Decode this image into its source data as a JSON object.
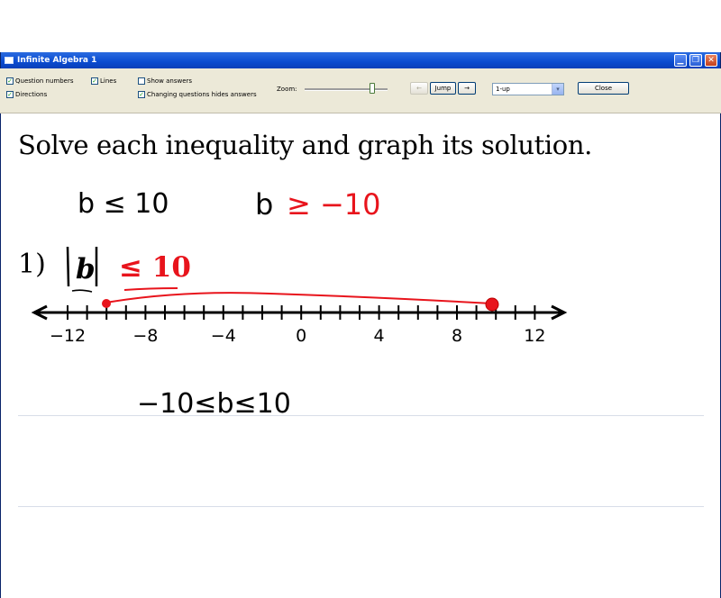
{
  "window": {
    "title": "Infinite Algebra 1"
  },
  "toolbar": {
    "question_numbers": "Question numbers",
    "lines": "Lines",
    "directions": "Directions",
    "show_answers": "Show answers",
    "changing_hides": "Changing questions hides answers",
    "zoom_label": "Zoom:",
    "back_arrow": "←",
    "jump_label": "Jump",
    "forward_arrow": "→",
    "layout_select": "1-up",
    "close_label": "Close",
    "checked": {
      "question_numbers": true,
      "lines": true,
      "directions": true,
      "show_answers": false,
      "changing_hides": true
    }
  },
  "worksheet": {
    "instructions": "Solve each inequality and graph its solution.",
    "question_number": "1)",
    "problem_variable": "b",
    "problem_inequality": "≤ 10",
    "number_line_ticks": [
      "−12",
      "−8",
      "−4",
      "0",
      "4",
      "8",
      "12"
    ]
  },
  "handwriting": {
    "note_left": "b ≤ 10",
    "note_right_var": "b",
    "note_right_ineq": "≥ −10",
    "final_answer": "−10≤b≤10",
    "ink_black": "#000000",
    "ink_red": "#e8141c"
  }
}
